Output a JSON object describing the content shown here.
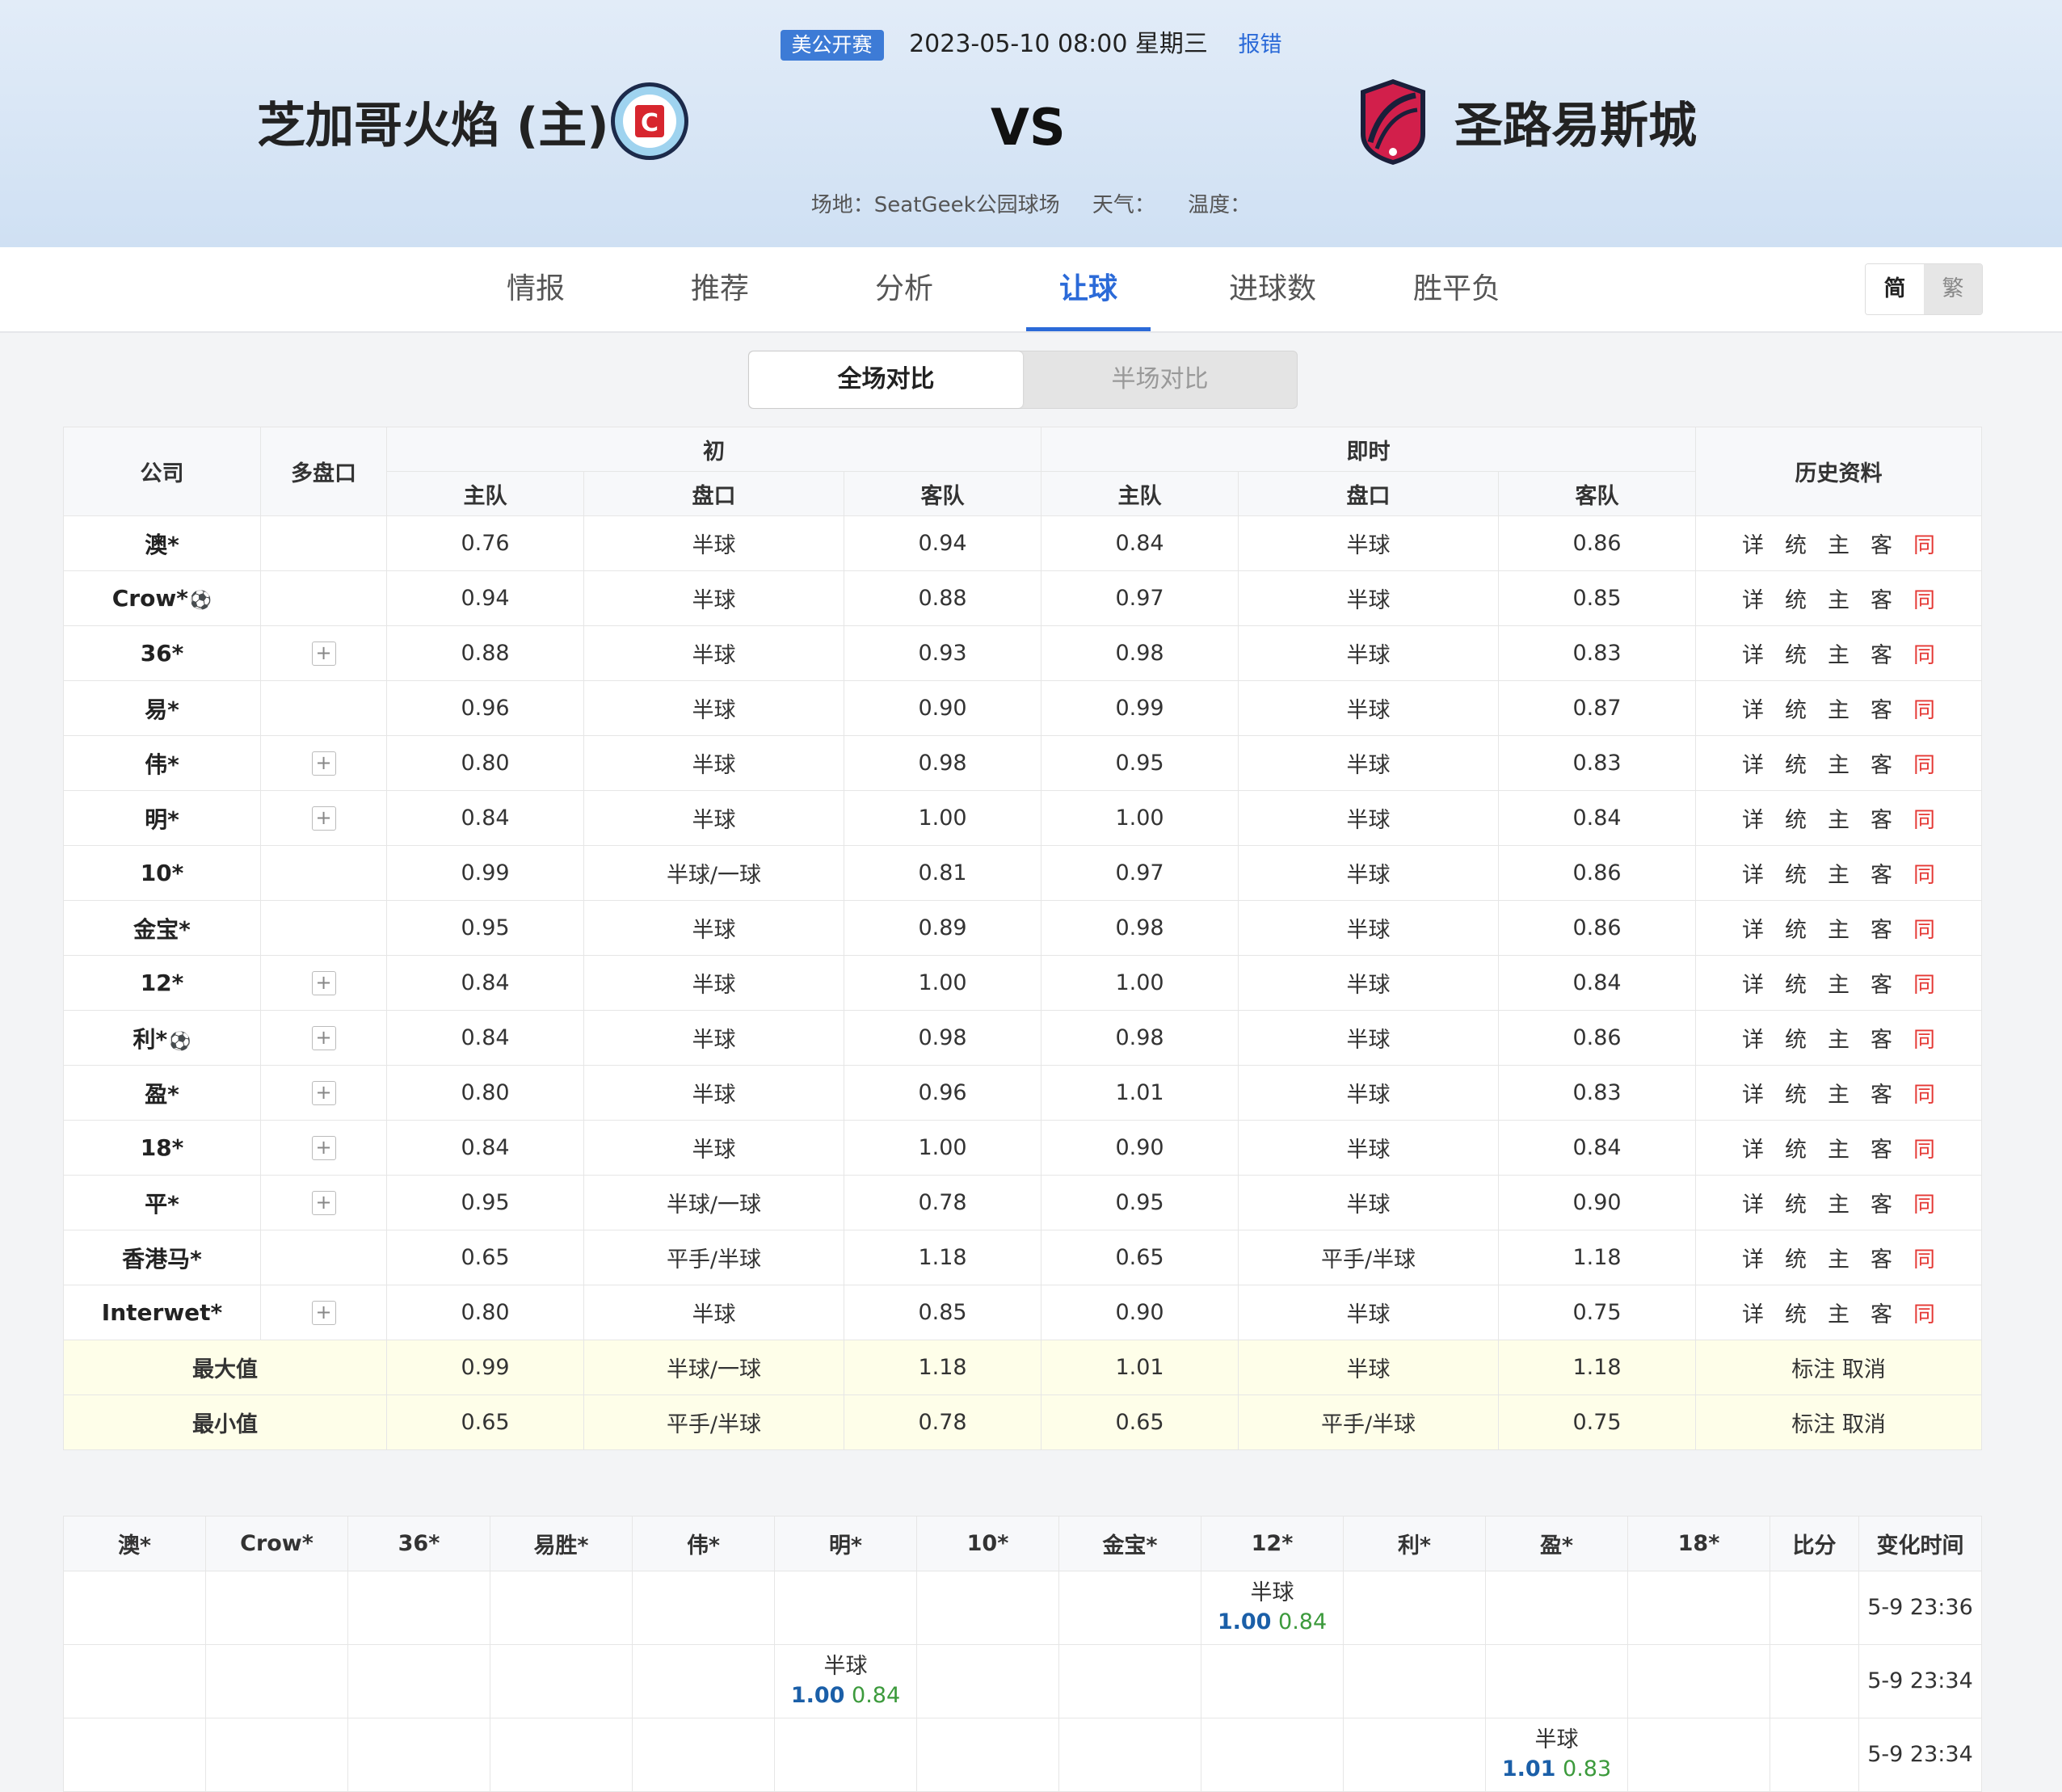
{
  "header": {
    "league": "美公开赛",
    "datetime": "2023-05-10 08:00 星期三",
    "report": "报错",
    "home_team": "芝加哥火焰 (主)",
    "away_team": "圣路易斯城",
    "vs": "VS",
    "venue": "场地：SeatGeek公园球场",
    "weather": "天气：",
    "temperature": "温度："
  },
  "nav": {
    "tabs": [
      "情报",
      "推荐",
      "分析",
      "让球",
      "进球数",
      "胜平负"
    ],
    "active": "让球",
    "lang_simplified": "简",
    "lang_traditional": "繁"
  },
  "segment": {
    "full": "全场对比",
    "half": "半场对比"
  },
  "table": {
    "h_company": "公司",
    "h_multi": "多盘口",
    "h_initial": "初",
    "h_live": "即时",
    "h_history": "历史资料",
    "h_home": "主队",
    "h_line": "盘口",
    "h_away": "客队",
    "history_links": [
      "详",
      "统",
      "主",
      "客",
      "同"
    ],
    "rows": [
      {
        "company": "澳*",
        "ball": false,
        "plus": false,
        "i_home": "0.76",
        "i_line": "半球",
        "i_away": "0.94",
        "l_home": "0.84",
        "l_line": "半球",
        "l_away": "0.86"
      },
      {
        "company": "Crow*",
        "ball": true,
        "plus": false,
        "i_home": "0.94",
        "i_line": "半球",
        "i_away": "0.88",
        "l_home": "0.97",
        "l_line": "半球",
        "l_away": "0.85"
      },
      {
        "company": "36*",
        "ball": false,
        "plus": true,
        "i_home": "0.88",
        "i_line": "半球",
        "i_away": "0.93",
        "l_home": "0.98",
        "l_line": "半球",
        "l_away": "0.83"
      },
      {
        "company": "易*",
        "ball": false,
        "plus": false,
        "i_home": "0.96",
        "i_line": "半球",
        "i_away": "0.90",
        "l_home": "0.99",
        "l_line": "半球",
        "l_away": "0.87"
      },
      {
        "company": "伟*",
        "ball": false,
        "plus": true,
        "i_home": "0.80",
        "i_line": "半球",
        "i_away": "0.98",
        "l_home": "0.95",
        "l_line": "半球",
        "l_away": "0.83"
      },
      {
        "company": "明*",
        "ball": false,
        "plus": true,
        "i_home": "0.84",
        "i_line": "半球",
        "i_away": "1.00",
        "l_home": "1.00",
        "l_line": "半球",
        "l_away": "0.84"
      },
      {
        "company": "10*",
        "ball": false,
        "plus": false,
        "i_home": "0.99",
        "i_line": "半球/一球",
        "i_away": "0.81",
        "l_home": "0.97",
        "l_line": "半球",
        "l_away": "0.86"
      },
      {
        "company": "金宝*",
        "ball": false,
        "plus": false,
        "i_home": "0.95",
        "i_line": "半球",
        "i_away": "0.89",
        "l_home": "0.98",
        "l_line": "半球",
        "l_away": "0.86"
      },
      {
        "company": "12*",
        "ball": false,
        "plus": true,
        "i_home": "0.84",
        "i_line": "半球",
        "i_away": "1.00",
        "l_home": "1.00",
        "l_line": "半球",
        "l_away": "0.84"
      },
      {
        "company": "利*",
        "ball": true,
        "plus": true,
        "i_home": "0.84",
        "i_line": "半球",
        "i_away": "0.98",
        "l_home": "0.98",
        "l_line": "半球",
        "l_away": "0.86"
      },
      {
        "company": "盈*",
        "ball": false,
        "plus": true,
        "i_home": "0.80",
        "i_line": "半球",
        "i_away": "0.96",
        "l_home": "1.01",
        "l_line": "半球",
        "l_away": "0.83"
      },
      {
        "company": "18*",
        "ball": false,
        "plus": true,
        "i_home": "0.84",
        "i_line": "半球",
        "i_away": "1.00",
        "l_home": "0.90",
        "l_line": "半球",
        "l_away": "0.84"
      },
      {
        "company": "平*",
        "ball": false,
        "plus": true,
        "i_home": "0.95",
        "i_line": "半球/一球",
        "i_away": "0.78",
        "l_home": "0.95",
        "l_line": "半球",
        "l_away": "0.90"
      },
      {
        "company": "香港马*",
        "ball": false,
        "plus": false,
        "i_home": "0.65",
        "i_line": "平手/半球",
        "i_away": "1.18",
        "l_home": "0.65",
        "l_line": "平手/半球",
        "l_away": "1.18"
      },
      {
        "company": "Interwet*",
        "ball": false,
        "plus": true,
        "i_home": "0.80",
        "i_line": "半球",
        "i_away": "0.85",
        "l_home": "0.90",
        "l_line": "半球",
        "l_away": "0.75"
      }
    ],
    "summary": [
      {
        "label": "最大值",
        "i_home": "0.99",
        "i_line": "半球/一球",
        "i_away": "1.18",
        "l_home": "1.01",
        "l_line": "半球",
        "l_away": "1.18",
        "actions": "标注 取消"
      },
      {
        "label": "最小值",
        "i_home": "0.65",
        "i_line": "平手/半球",
        "i_away": "0.78",
        "l_home": "0.65",
        "l_line": "平手/半球",
        "l_away": "0.75",
        "actions": "标注 取消"
      }
    ]
  },
  "changes": {
    "headers": [
      "澳*",
      "Crow*",
      "36*",
      "易胜*",
      "伟*",
      "明*",
      "10*",
      "金宝*",
      "12*",
      "利*",
      "盈*",
      "18*",
      "比分",
      "变化时间"
    ],
    "rows": [
      {
        "col": 8,
        "line": "半球",
        "home": "1.00",
        "away": "0.84",
        "time": "5-9 23:36"
      },
      {
        "col": 5,
        "line": "半球",
        "home": "1.00",
        "away": "0.84",
        "time": "5-9 23:34"
      },
      {
        "col": 10,
        "line": "半球",
        "home": "1.01",
        "away": "0.83",
        "time": "5-9 23:34"
      }
    ]
  },
  "colors": {
    "accent": "#2b6ad8",
    "same_link": "#e53935",
    "summary_bg": "#fefee9"
  }
}
